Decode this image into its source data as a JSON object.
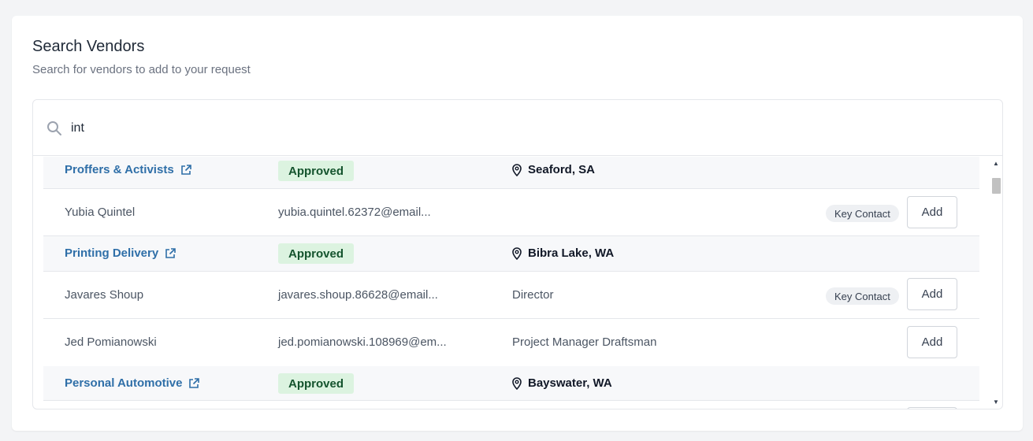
{
  "header": {
    "title": "Search Vendors",
    "subtitle": "Search for vendors to add to your request"
  },
  "search": {
    "value": "int",
    "placeholder": ""
  },
  "icons": {
    "search": "search-icon",
    "external_link": "external-link-icon",
    "location_pin": "map-pin-icon"
  },
  "colors": {
    "vendor_link": "#2f6fa8",
    "approved_bg": "#dcf3e0",
    "approved_text": "#14532d"
  },
  "results": [
    {
      "type": "vendor",
      "name": "Proffers & Activists",
      "status": "Approved",
      "location": "Seaford, SA"
    },
    {
      "type": "contact",
      "name": "Yubia Quintel",
      "email": "yubia.quintel.62372@email...",
      "title": "",
      "key_contact": "Key Contact",
      "action": "Add"
    },
    {
      "type": "vendor",
      "name": "Printing Delivery",
      "status": "Approved",
      "location": "Bibra Lake, WA"
    },
    {
      "type": "contact",
      "name": "Javares Shoup",
      "email": "javares.shoup.86628@email...",
      "title": "Director",
      "key_contact": "Key Contact",
      "action": "Add"
    },
    {
      "type": "contact",
      "name": "Jed Pomianowski",
      "email": "jed.pomianowski.108969@em...",
      "title": "Project Manager Draftsman",
      "key_contact": "",
      "action": "Add"
    },
    {
      "type": "vendor",
      "name": "Personal Automotive",
      "status": "Approved",
      "location": "Bayswater, WA"
    }
  ],
  "scrollbar": {
    "up_glyph": "▲",
    "down_glyph": "▼"
  }
}
